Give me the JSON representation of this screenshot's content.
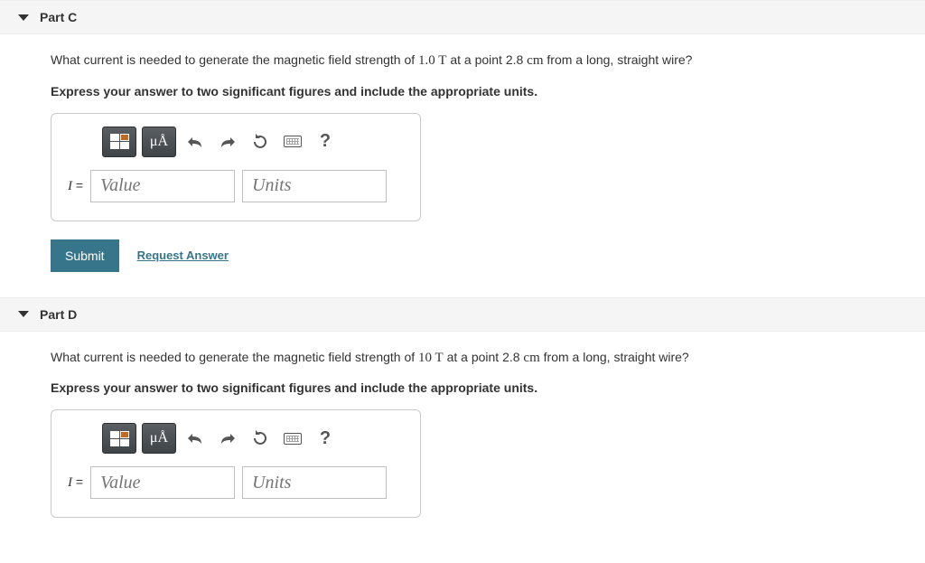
{
  "partC": {
    "title": "Part C",
    "question_pre": "What current is needed to generate the magnetic field strength of ",
    "q_val1": "1.0 T",
    "question_mid": " at a point 2.8 ",
    "q_unit": "cm",
    "question_post": " from a long, straight wire?",
    "instruction": "Express your answer to two significant figures and include the appropriate units.",
    "tool_mu": "μÅ",
    "var": "I",
    "eq": " = ",
    "value_ph": "Value",
    "units_ph": "Units",
    "submit": "Submit",
    "request": "Request Answer",
    "help": "?"
  },
  "partD": {
    "title": "Part D",
    "question_pre": "What current is needed to generate the magnetic field strength of ",
    "q_val1": "10 T",
    "question_mid": " at a point 2.8 ",
    "q_unit": "cm",
    "question_post": " from a long, straight wire?",
    "instruction": "Express your answer to two significant figures and include the appropriate units.",
    "tool_mu": "μÅ",
    "var": "I",
    "eq": " = ",
    "value_ph": "Value",
    "units_ph": "Units",
    "help": "?"
  }
}
